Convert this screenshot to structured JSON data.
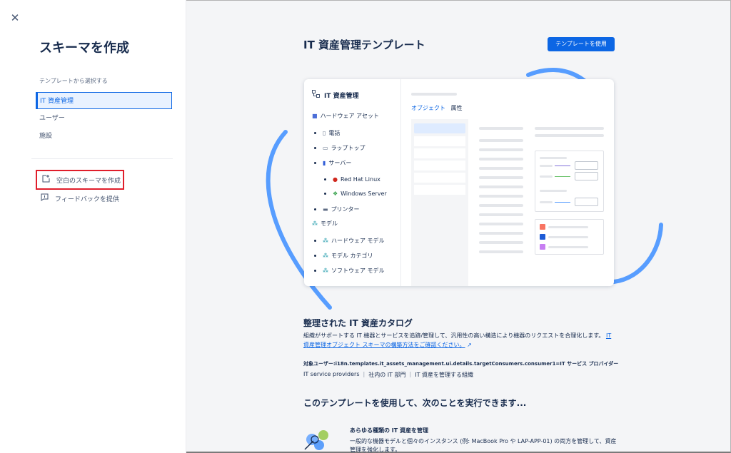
{
  "sidebar": {
    "close_icon": "close-icon",
    "title": "スキーマを作成",
    "section_label": "テンプレートから選択する",
    "templates": [
      {
        "label": "IT 資産管理",
        "selected": true
      },
      {
        "label": "ユーザー",
        "selected": false
      },
      {
        "label": "施設",
        "selected": false
      }
    ],
    "actions": [
      {
        "label": "空白のスキーマを作成",
        "icon": "new-schema-icon"
      },
      {
        "label": "フィードバックを提供",
        "icon": "feedback-icon"
      }
    ]
  },
  "main": {
    "title": "IT 資産管理テンプレート",
    "use_button": "テンプレートを使用",
    "preview": {
      "header": "IT 資産管理",
      "tabs": {
        "objects": "オブジェクト",
        "attributes": "属性"
      },
      "tree": [
        {
          "label": "ハードウェア アセット",
          "icon": "hardware-icon"
        },
        {
          "label": "電話",
          "icon": "phone-icon"
        },
        {
          "label": "ラップトップ",
          "icon": "laptop-icon"
        },
        {
          "label": "サーバー",
          "icon": "server-icon"
        },
        {
          "label": "Red Hat Linux",
          "icon": "redhat-icon"
        },
        {
          "label": "Windows Server",
          "icon": "windows-icon"
        },
        {
          "label": "プリンター",
          "icon": "printer-icon"
        },
        {
          "label": "モデル",
          "icon": "model-icon"
        },
        {
          "label": "ハードウェア モデル",
          "icon": "model-icon"
        },
        {
          "label": "モデル カテゴリ",
          "icon": "model-icon"
        },
        {
          "label": "ソフトウェア モデル",
          "icon": "model-icon"
        }
      ]
    },
    "catalog_title": "整理された IT 資産カタログ",
    "catalog_desc": "組織がサポートする IT 機器とサービスを追跡/管理して、汎用性の高い構造により機器のリクエストを合理化します。",
    "catalog_link": "IT 資産管理オブジェクト スキーマの構築方法をご確認ください。",
    "target_label": "対象ユーザー:i18n.templates.it_assets_management.ui.details.targetConsumers.consumer1=IT サービス プロバイダー",
    "targets": [
      "IT service providers",
      "社内の IT 部門",
      "IT 資産を管理する組織"
    ],
    "can_title": "このテンプレートを使用して、次のことを実行できます...",
    "feature": {
      "title": "あらゆる種類の IT 資産を管理",
      "desc": "一般的な機器モデルと個々のインスタンス (例: MacBook Pro や LAP-APP-01) の両方を管理して、資産管理を強化します。"
    }
  },
  "colors": {
    "accent": "#0c66e4",
    "highlight_border": "#e01e2b",
    "decor_blue": "#579dff"
  }
}
